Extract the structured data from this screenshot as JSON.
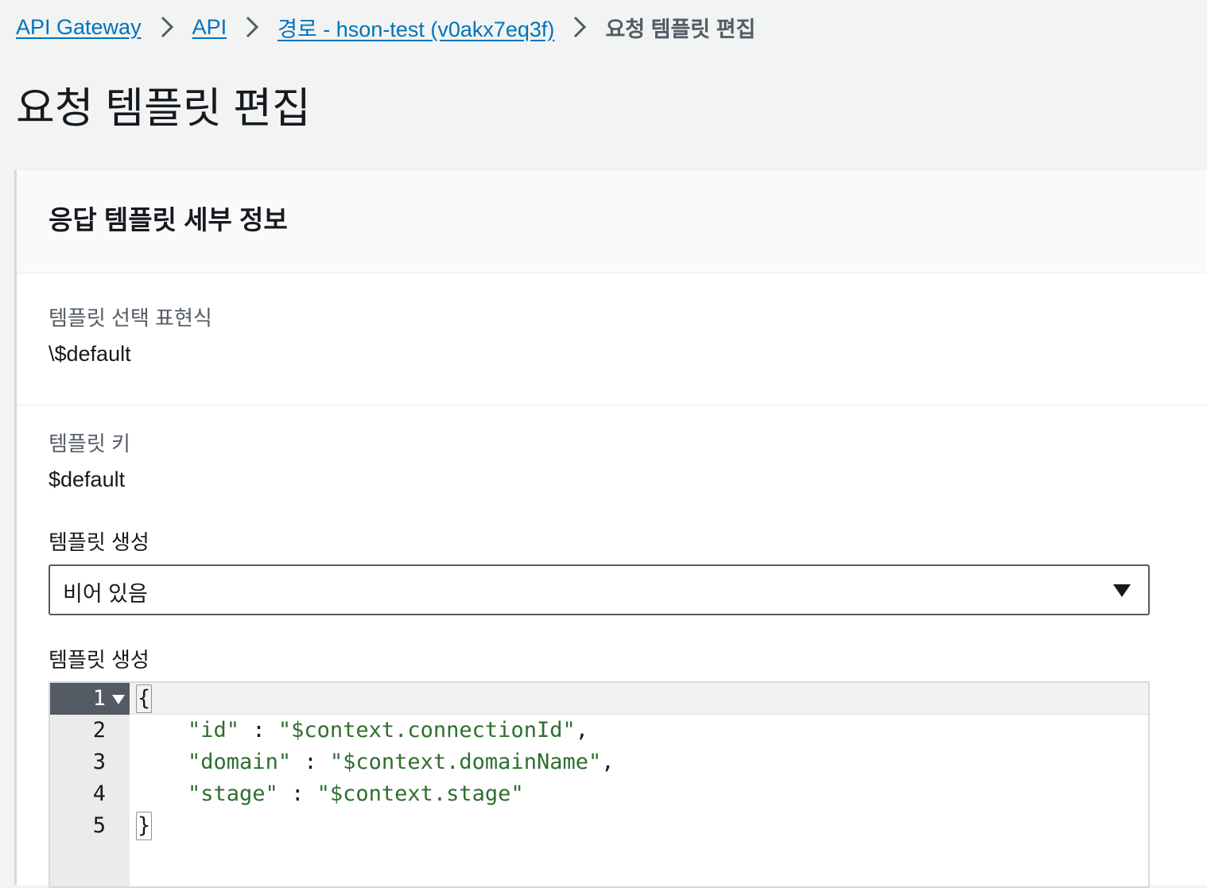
{
  "breadcrumb": {
    "items": [
      {
        "label": "API Gateway"
      },
      {
        "label": "API"
      },
      {
        "label": "경로 - hson-test (v0akx7eq3f)"
      }
    ],
    "current": "요청 템플릿 편집"
  },
  "page": {
    "title": "요청 템플릿 편집"
  },
  "panel": {
    "title": "응답 템플릿 세부 정보",
    "selection_expression": {
      "label": "템플릿 선택 표현식",
      "value": "\\$default"
    },
    "template_key": {
      "label": "템플릿 키",
      "value": "$default"
    },
    "generate_template": {
      "label": "템플릿 생성",
      "selected": "비어 있음"
    },
    "template_body": {
      "label": "템플릿 생성",
      "lines": [
        {
          "number": "1",
          "open": "{"
        },
        {
          "number": "2",
          "key": "\"id\"",
          "sep": " : ",
          "value": "\"$context.connectionId\"",
          "tail": ","
        },
        {
          "number": "3",
          "key": "\"domain\"",
          "sep": " : ",
          "value": "\"$context.domainName\"",
          "tail": ","
        },
        {
          "number": "4",
          "key": "\"stage\"",
          "sep": " : ",
          "value": "\"$context.stage\"",
          "tail": ""
        },
        {
          "number": "5",
          "close": "}"
        }
      ]
    }
  },
  "colors": {
    "link": "#0073bb",
    "string": "#2f6e2f",
    "active_gutter": "#545b64"
  },
  "icons": [
    "chevron-right-icon",
    "caret-down-icon",
    "fold-caret-icon"
  ]
}
